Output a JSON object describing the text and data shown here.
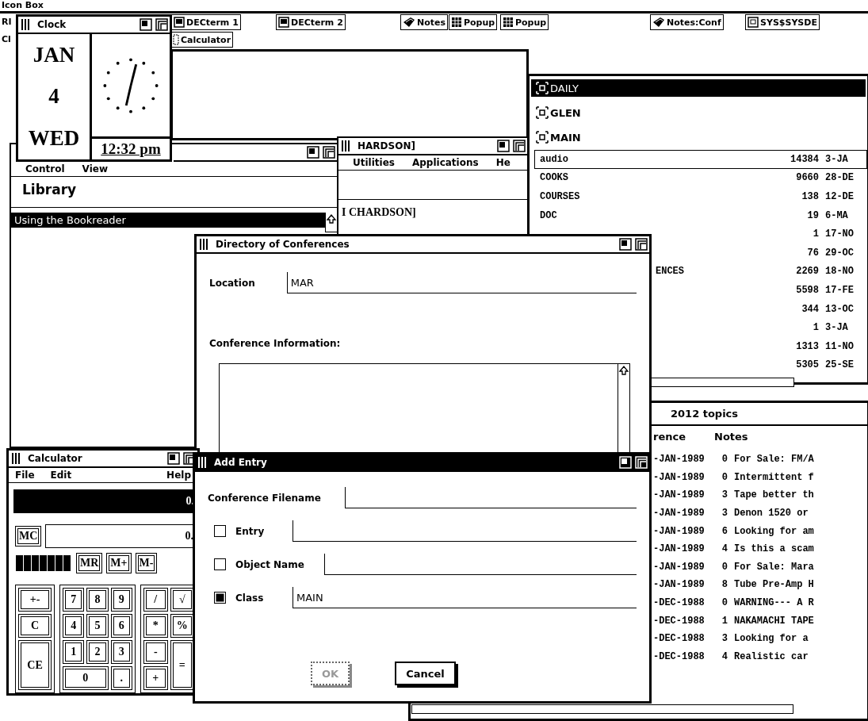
{
  "icon_box": {
    "title": "Icon Box",
    "icons": [
      {
        "label": "RI",
        "kind": "cut"
      },
      {
        "label": "DECterm 1",
        "kind": "terminal"
      },
      {
        "label": "DECterm 2",
        "kind": "terminal"
      },
      {
        "label": "Notes",
        "kind": "notes"
      },
      {
        "label": "Popup",
        "kind": "popup"
      },
      {
        "label": "Popup",
        "kind": "popup"
      },
      {
        "label": "Notes:Conf",
        "kind": "notes"
      },
      {
        "label": "SYS$SYSDE",
        "kind": "system"
      }
    ],
    "second_row": [
      {
        "label": "Cl",
        "kind": "cut"
      },
      {
        "label": "Calculator",
        "kind": "calculator"
      }
    ]
  },
  "session_window": {
    "title": "HARDSON]",
    "active": false,
    "menu": [
      "Utilities",
      "Applications",
      "He"
    ],
    "text": "I CHARDSON]"
  },
  "bookreader": {
    "active": false,
    "menu": [
      "Control",
      "View"
    ],
    "heading": "Library",
    "items": [
      {
        "title": "Using the Bookreader",
        "selected": true
      }
    ]
  },
  "daily_window": {
    "classes": [
      {
        "name": "DAILY",
        "selected": true
      },
      {
        "name": "GLEN",
        "selected": false
      },
      {
        "name": "MAIN",
        "selected": false
      }
    ],
    "entries": [
      {
        "name": "audio",
        "count": "14384",
        "date": "3-JA",
        "focused": true,
        "kind": "full"
      },
      {
        "name": "COOKS",
        "count": "9660",
        "date": "28-DE",
        "focused": false,
        "kind": "full"
      },
      {
        "name": "COURSES",
        "count": "138",
        "date": "12-DE",
        "focused": false,
        "kind": "full"
      },
      {
        "name": "DOC",
        "count": "19",
        "date": "6-MA",
        "focused": false,
        "kind": "full"
      },
      {
        "count": "1",
        "date": "17-NO",
        "kind": "hidden"
      },
      {
        "count": "76",
        "date": "29-OC",
        "kind": "hidden"
      },
      {
        "name": "ENCES",
        "count": "2269",
        "date": "18-NO",
        "kind": "clipped"
      },
      {
        "count": "5598",
        "date": "17-FE",
        "kind": "hidden"
      },
      {
        "count": "344",
        "date": "13-OC",
        "kind": "hidden"
      },
      {
        "count": "1",
        "date": "3-JA",
        "kind": "hidden"
      },
      {
        "count": "1313",
        "date": "11-NO",
        "kind": "hidden"
      },
      {
        "count": "5305",
        "date": "25-SE",
        "kind": "hidden"
      }
    ]
  },
  "notes_window": {
    "header": "2012 topics",
    "columns": [
      "rence",
      "Notes"
    ],
    "rows": [
      {
        "date": "-JAN-1989",
        "count": "0",
        "topic": "For Sale: FM/A"
      },
      {
        "date": "-JAN-1989",
        "count": "0",
        "topic": "Intermittent f"
      },
      {
        "date": "-JAN-1989",
        "count": "3",
        "topic": "Tape better th"
      },
      {
        "date": "-JAN-1989",
        "count": "3",
        "topic": "Denon 1520 or"
      },
      {
        "date": "-JAN-1989",
        "count": "6",
        "topic": "Looking for am"
      },
      {
        "date": "-JAN-1989",
        "count": "4",
        "topic": "Is this a scam"
      },
      {
        "date": "-JAN-1989",
        "count": "0",
        "topic": "For Sale: Mara"
      },
      {
        "date": "-JAN-1989",
        "count": "8",
        "topic": "Tube Pre-Amp H"
      },
      {
        "date": "-DEC-1988",
        "count": "0",
        "topic": "WARNING--- A R"
      },
      {
        "date": "-DEC-1988",
        "count": "1",
        "topic": "NAKAMACHI TAPE"
      },
      {
        "date": "-DEC-1988",
        "count": "3",
        "topic": "Looking for a"
      },
      {
        "date": "-DEC-1988",
        "count": "4",
        "topic": "Realistic car"
      }
    ]
  },
  "directory": {
    "title": "Directory of Conferences",
    "active": false,
    "location_label": "Location",
    "location_value": "MAR",
    "info_label": "Conference Information:"
  },
  "calculator": {
    "title": "Calculator",
    "active": false,
    "menu": [
      "File",
      "Edit"
    ],
    "help": "Help",
    "display": "0.",
    "memory_key": "MC",
    "memory_value": "0.",
    "memory_keys": [
      "MR",
      "M+",
      "M-"
    ],
    "left_keys": [
      "+-",
      "C",
      "CE"
    ],
    "digit_keys": [
      "7",
      "8",
      "9",
      "4",
      "5",
      "6",
      "1",
      "2",
      "3",
      "0",
      "."
    ],
    "op_keys": [
      "/",
      "√",
      "*",
      "%",
      "-",
      "=",
      "+"
    ]
  },
  "add_entry": {
    "title": "Add Entry",
    "active": true,
    "filename_label": "Conference Filename",
    "options": [
      {
        "label": "Entry",
        "checked": false
      },
      {
        "label": "Object Name",
        "checked": false
      },
      {
        "label": "Class",
        "checked": true,
        "value": "MAIN"
      }
    ],
    "buttons": [
      {
        "label": "OK",
        "disabled": true
      },
      {
        "label": "Cancel",
        "disabled": false
      }
    ]
  },
  "clock": {
    "title": "Clock",
    "active": false,
    "month": "JAN",
    "day": "4",
    "weekday": "WED",
    "time": "12:32 pm"
  }
}
